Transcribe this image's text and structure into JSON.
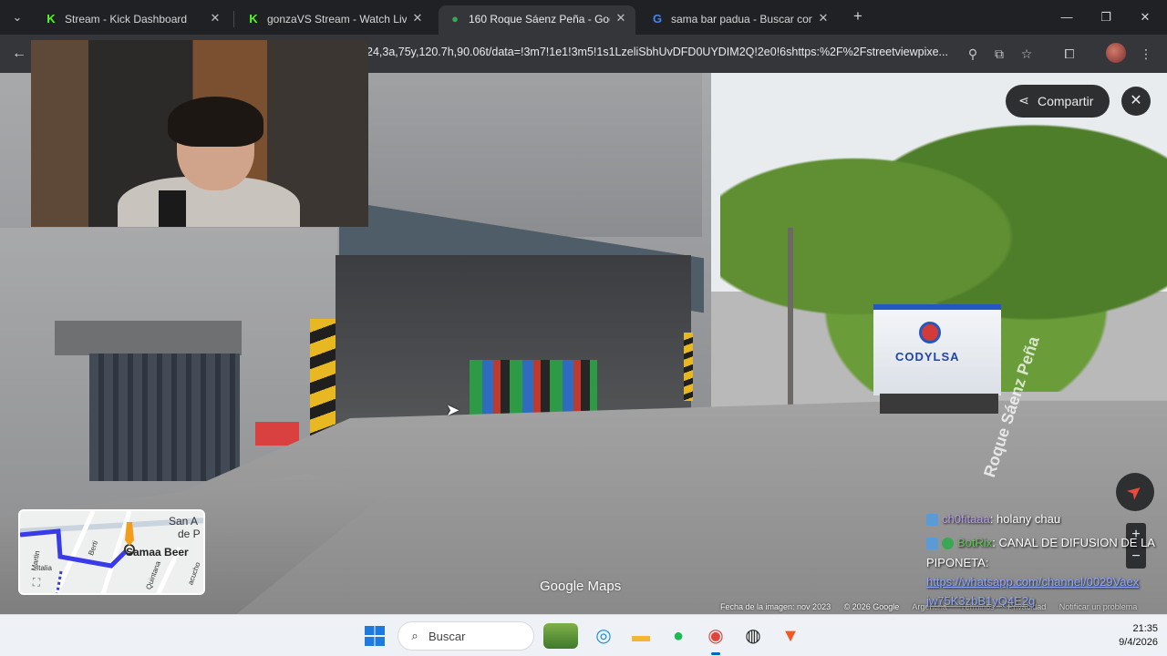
{
  "browser": {
    "tabs": [
      {
        "title": "Stream - Kick Dashboard",
        "favicon": "kick-logo-icon",
        "active": false
      },
      {
        "title": "gonzaVS Stream - Watch Live o",
        "favicon": "kick-logo-icon",
        "active": false
      },
      {
        "title": "160 Roque Sáenz Peña - Googl",
        "favicon": "google-maps-pin-icon",
        "active": true
      },
      {
        "title": "sama bar padua - Buscar con G",
        "favicon": "google-g-icon",
        "active": false
      }
    ],
    "url": "24,3a,75y,120.7h,90.06t/data=!3m7!1e1!3m5!1s1LzeliSbhUvDFD0UYDIM2Q!2e0!6shttps:%2F%2Fstreetviewpixe...",
    "colors": {
      "tabstrip": "#202124",
      "toolbar": "#35363a"
    }
  },
  "streetview": {
    "share_label": "Compartir",
    "truck_text": "CODYLSA",
    "street_label": "Roque Sáenz Peña",
    "logo": "Google Maps",
    "attribution": {
      "image_date": "Fecha de la imagen: nov 2023",
      "copyright": "© 2026 Google",
      "country": "Argentina",
      "terms": "Términos",
      "privacy": "Privacidad",
      "report": "Notificar un problema"
    },
    "minimap": {
      "labels": [
        "San A",
        "de P",
        "Martin",
        "Berti",
        "Italia",
        "Quintana",
        "acucho"
      ],
      "place": "Samaa Beer"
    }
  },
  "chat": {
    "messages": [
      {
        "user": "ch0fitaaa",
        "text": ": holany chau"
      },
      {
        "user": "BotRix",
        "text": ": CANAL DE DIFUSION DE LA"
      },
      {
        "user": "",
        "text": "PIPONETA:"
      },
      {
        "user": "",
        "text": "https://whatsapp.com/channel/0029Vaex"
      },
      {
        "user": "",
        "text": "jw75K3zbB1yQ4E2g"
      }
    ]
  },
  "taskbar": {
    "search_placeholder": "Buscar",
    "time": "21:35",
    "date": "9/4/2026",
    "apps": [
      "widgets-icon",
      "edge-icon",
      "file-explorer-icon",
      "spotify-icon",
      "chrome-icon",
      "obs-icon",
      "brave-icon"
    ]
  }
}
